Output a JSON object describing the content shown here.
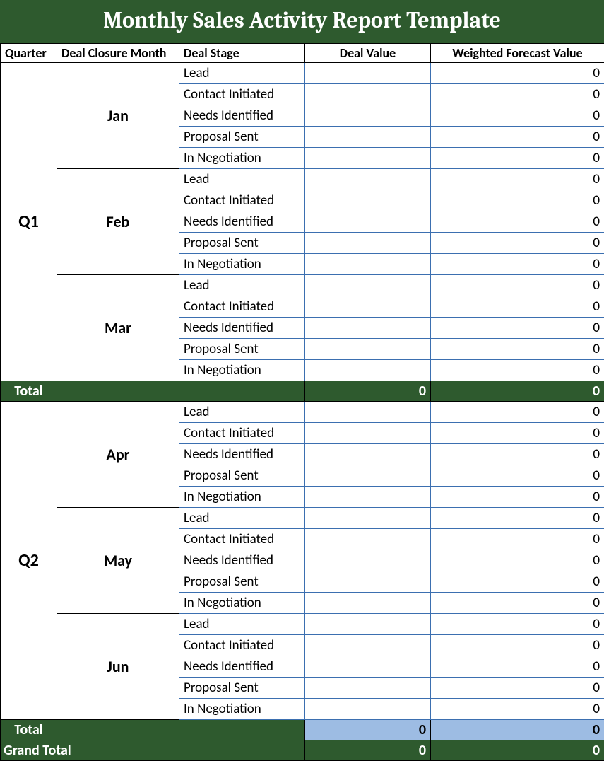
{
  "title": "Monthly Sales Activity Report Template",
  "headers": {
    "quarter": "Quarter",
    "month": "Deal Closure Month",
    "stage": "Deal Stage",
    "value": "Deal Value",
    "forecast": "Weighted Forecast Value"
  },
  "quarters": [
    {
      "name": "Q1",
      "months": [
        {
          "name": "Jan",
          "stages": [
            {
              "stage": "Lead",
              "value": "",
              "forecast": "0"
            },
            {
              "stage": "Contact Initiated",
              "value": "",
              "forecast": "0"
            },
            {
              "stage": "Needs Identified",
              "value": "",
              "forecast": "0"
            },
            {
              "stage": "Proposal Sent",
              "value": "",
              "forecast": "0"
            },
            {
              "stage": "In Negotiation",
              "value": "",
              "forecast": "0"
            }
          ]
        },
        {
          "name": "Feb",
          "stages": [
            {
              "stage": "Lead",
              "value": "",
              "forecast": "0"
            },
            {
              "stage": "Contact Initiated",
              "value": "",
              "forecast": "0"
            },
            {
              "stage": "Needs Identified",
              "value": "",
              "forecast": "0"
            },
            {
              "stage": "Proposal Sent",
              "value": "",
              "forecast": "0"
            },
            {
              "stage": "In Negotiation",
              "value": "",
              "forecast": "0"
            }
          ]
        },
        {
          "name": "Mar",
          "stages": [
            {
              "stage": "Lead",
              "value": "",
              "forecast": "0"
            },
            {
              "stage": "Contact Initiated",
              "value": "",
              "forecast": "0"
            },
            {
              "stage": "Needs Identified",
              "value": "",
              "forecast": "0"
            },
            {
              "stage": "Proposal Sent",
              "value": "",
              "forecast": "0"
            },
            {
              "stage": "In Negotiation",
              "value": "",
              "forecast": "0"
            }
          ]
        }
      ],
      "total": {
        "label": "Total",
        "value": "0",
        "forecast": "0",
        "selected": false
      }
    },
    {
      "name": "Q2",
      "months": [
        {
          "name": "Apr",
          "stages": [
            {
              "stage": "Lead",
              "value": "",
              "forecast": "0"
            },
            {
              "stage": "Contact Initiated",
              "value": "",
              "forecast": "0"
            },
            {
              "stage": "Needs Identified",
              "value": "",
              "forecast": "0"
            },
            {
              "stage": "Proposal Sent",
              "value": "",
              "forecast": "0"
            },
            {
              "stage": "In Negotiation",
              "value": "",
              "forecast": "0"
            }
          ]
        },
        {
          "name": "May",
          "stages": [
            {
              "stage": "Lead",
              "value": "",
              "forecast": "0"
            },
            {
              "stage": "Contact Initiated",
              "value": "",
              "forecast": "0"
            },
            {
              "stage": "Needs Identified",
              "value": "",
              "forecast": "0"
            },
            {
              "stage": "Proposal Sent",
              "value": "",
              "forecast": "0"
            },
            {
              "stage": "In Negotiation",
              "value": "",
              "forecast": "0"
            }
          ]
        },
        {
          "name": "Jun",
          "stages": [
            {
              "stage": "Lead",
              "value": "",
              "forecast": "0"
            },
            {
              "stage": "Contact Initiated",
              "value": "",
              "forecast": "0"
            },
            {
              "stage": "Needs Identified",
              "value": "",
              "forecast": "0"
            },
            {
              "stage": "Proposal Sent",
              "value": "",
              "forecast": "0"
            },
            {
              "stage": "In Negotiation",
              "value": "",
              "forecast": "0"
            }
          ]
        }
      ],
      "total": {
        "label": "Total",
        "value": "0",
        "forecast": "0",
        "selected": true
      }
    }
  ],
  "grand_total": {
    "label": "Grand Total",
    "value": "0",
    "forecast": "0"
  }
}
